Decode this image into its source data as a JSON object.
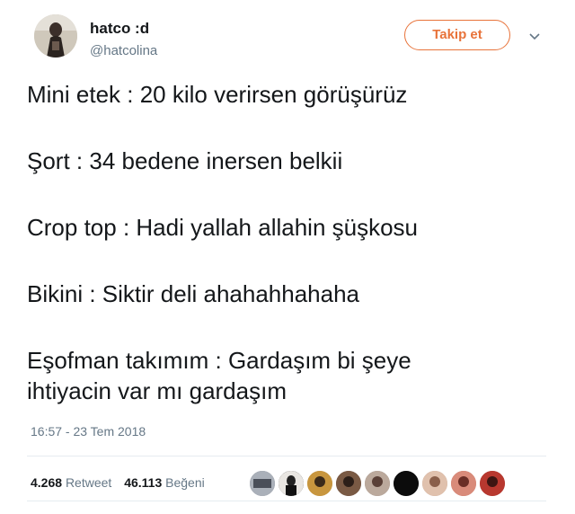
{
  "user": {
    "name": "hatco :d",
    "handle": "@hatcolina",
    "follow_label": "Takip et"
  },
  "tweet": {
    "line1": "Mini etek : 20 kilo verirsen görüşürüz",
    "line2": "Şort : 34 bedene inersen belkii",
    "line3": "Crop top : Hadi yallah allahin şüşkosu",
    "line4": "Bikini : Siktir deli ahahahhahaha",
    "line5a": "Eşofman takımım : Gardaşım bi şeye",
    "line5b": "ihtiyacin var mı gardaşım"
  },
  "timestamp": "16:57 - 23 Tem 2018",
  "stats": {
    "retweets": "4.268",
    "retweets_label": "Retweet",
    "likes": "46.113",
    "likes_label": "Beğeni"
  },
  "colors": {
    "accent": "#e8733a",
    "muted": "#657786",
    "text": "#14171a"
  },
  "icons": {
    "menu": "chevron-down-icon"
  }
}
